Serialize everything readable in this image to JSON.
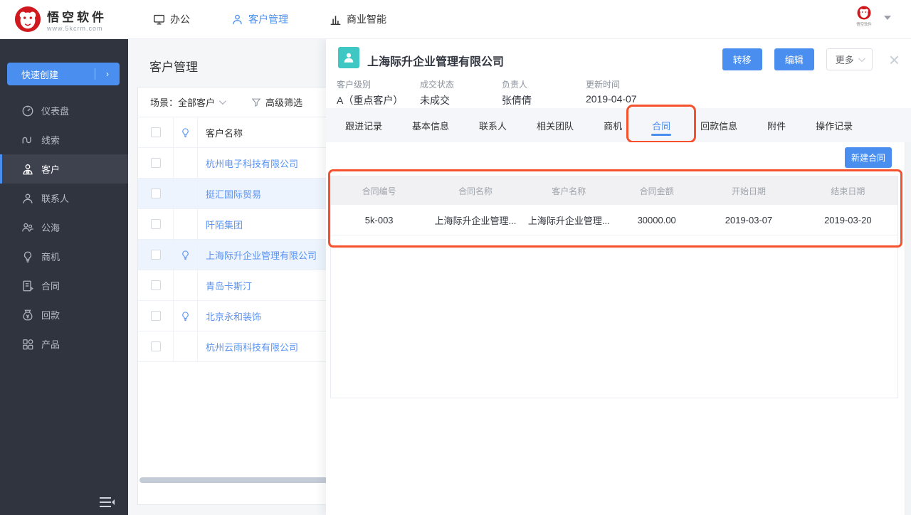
{
  "topnav": {
    "logo": {
      "title": "悟空软件",
      "url": "www.5kcrm.com"
    },
    "items": [
      {
        "label": "办公",
        "icon": "monitor-icon",
        "active": false
      },
      {
        "label": "客户管理",
        "icon": "person-icon",
        "active": true
      },
      {
        "label": "商业智能",
        "icon": "bar-chart-icon",
        "active": false
      }
    ],
    "user": {
      "caption": "悟空软件"
    }
  },
  "sidebar": {
    "quick_create_label": "快速创建",
    "items": [
      {
        "label": "仪表盘",
        "icon": "dashboard-icon",
        "active": false
      },
      {
        "label": "线索",
        "icon": "leads-icon",
        "active": false
      },
      {
        "label": "客户",
        "icon": "customer-icon",
        "active": true
      },
      {
        "label": "联系人",
        "icon": "contact-icon",
        "active": false
      },
      {
        "label": "公海",
        "icon": "public-pool-icon",
        "active": false
      },
      {
        "label": "商机",
        "icon": "opportunity-bulb-icon",
        "active": false
      },
      {
        "label": "合同",
        "icon": "contract-doc-icon",
        "active": false
      },
      {
        "label": "回款",
        "icon": "money-bag-icon",
        "active": false
      },
      {
        "label": "产品",
        "icon": "product-grid-icon",
        "active": false
      }
    ]
  },
  "customer_list": {
    "title": "客户管理",
    "scene_label": "场景：全部客户",
    "filter_label": "高级筛选",
    "name_header": "客户名称",
    "rows": [
      {
        "name": "杭州电子科技有限公司",
        "bulb": false,
        "selected": false
      },
      {
        "name": "挺汇国际贸易",
        "bulb": false,
        "selected": true
      },
      {
        "name": "阡陌集团",
        "bulb": false,
        "selected": false
      },
      {
        "name": "上海际升企业管理有限公司",
        "bulb": true,
        "selected": true
      },
      {
        "name": "青岛卡斯汀",
        "bulb": false,
        "selected": false
      },
      {
        "name": "北京永和装饰",
        "bulb": true,
        "selected": false
      },
      {
        "name": "杭州云雨科技有限公司",
        "bulb": false,
        "selected": false
      }
    ]
  },
  "detail": {
    "title": "上海际升企业管理有限公司",
    "actions": {
      "transfer": "转移",
      "edit": "编辑",
      "more": "更多"
    },
    "meta": [
      {
        "label": "客户级别",
        "value": "A（重点客户）"
      },
      {
        "label": "成交状态",
        "value": "未成交"
      },
      {
        "label": "负责人",
        "value": "张倩倩"
      },
      {
        "label": "更新时间",
        "value": "2019-04-07"
      }
    ],
    "tabs": [
      {
        "label": "跟进记录",
        "active": false
      },
      {
        "label": "基本信息",
        "active": false
      },
      {
        "label": "联系人",
        "active": false
      },
      {
        "label": "相关团队",
        "active": false
      },
      {
        "label": "商机",
        "active": false
      },
      {
        "label": "合同",
        "active": true,
        "annotated": true
      },
      {
        "label": "回款信息",
        "active": false
      },
      {
        "label": "附件",
        "active": false
      },
      {
        "label": "操作记录",
        "active": false
      }
    ],
    "new_contract_label": "新建合同",
    "contracts": {
      "headers": [
        "合同编号",
        "合同名称",
        "客户名称",
        "合同金额",
        "开始日期",
        "结束日期"
      ],
      "rows": [
        [
          "5k-003",
          "上海际升企业管理...",
          "上海际升企业管理...",
          "30000.00",
          "2019-03-07",
          "2019-03-20"
        ]
      ]
    }
  },
  "colors": {
    "accent_blue": "#4a8ff0",
    "annotation_orange": "#f4512c",
    "avatar_teal": "#3fc8c3",
    "logo_red": "#d0191f",
    "sidebar_dark": "#30343f",
    "selected_row_blue": "#edf4fd"
  },
  "icons": {
    "monitor-icon": "display",
    "person-icon": "user",
    "bar-chart-icon": "bars",
    "dashboard-icon": "gauge",
    "leads-icon": "wave",
    "customer-icon": "user",
    "contact-icon": "user-outline",
    "public-pool-icon": "users",
    "opportunity-bulb-icon": "bulb",
    "contract-doc-icon": "document",
    "money-bag-icon": "money-bag",
    "product-grid-icon": "grid",
    "filter-funnel-icon": "funnel",
    "lightbulb-flag-icon": "bulb",
    "close-icon": "x",
    "chevron-down-icon": "chevron",
    "collapse-sidebar-icon": "collapse"
  }
}
